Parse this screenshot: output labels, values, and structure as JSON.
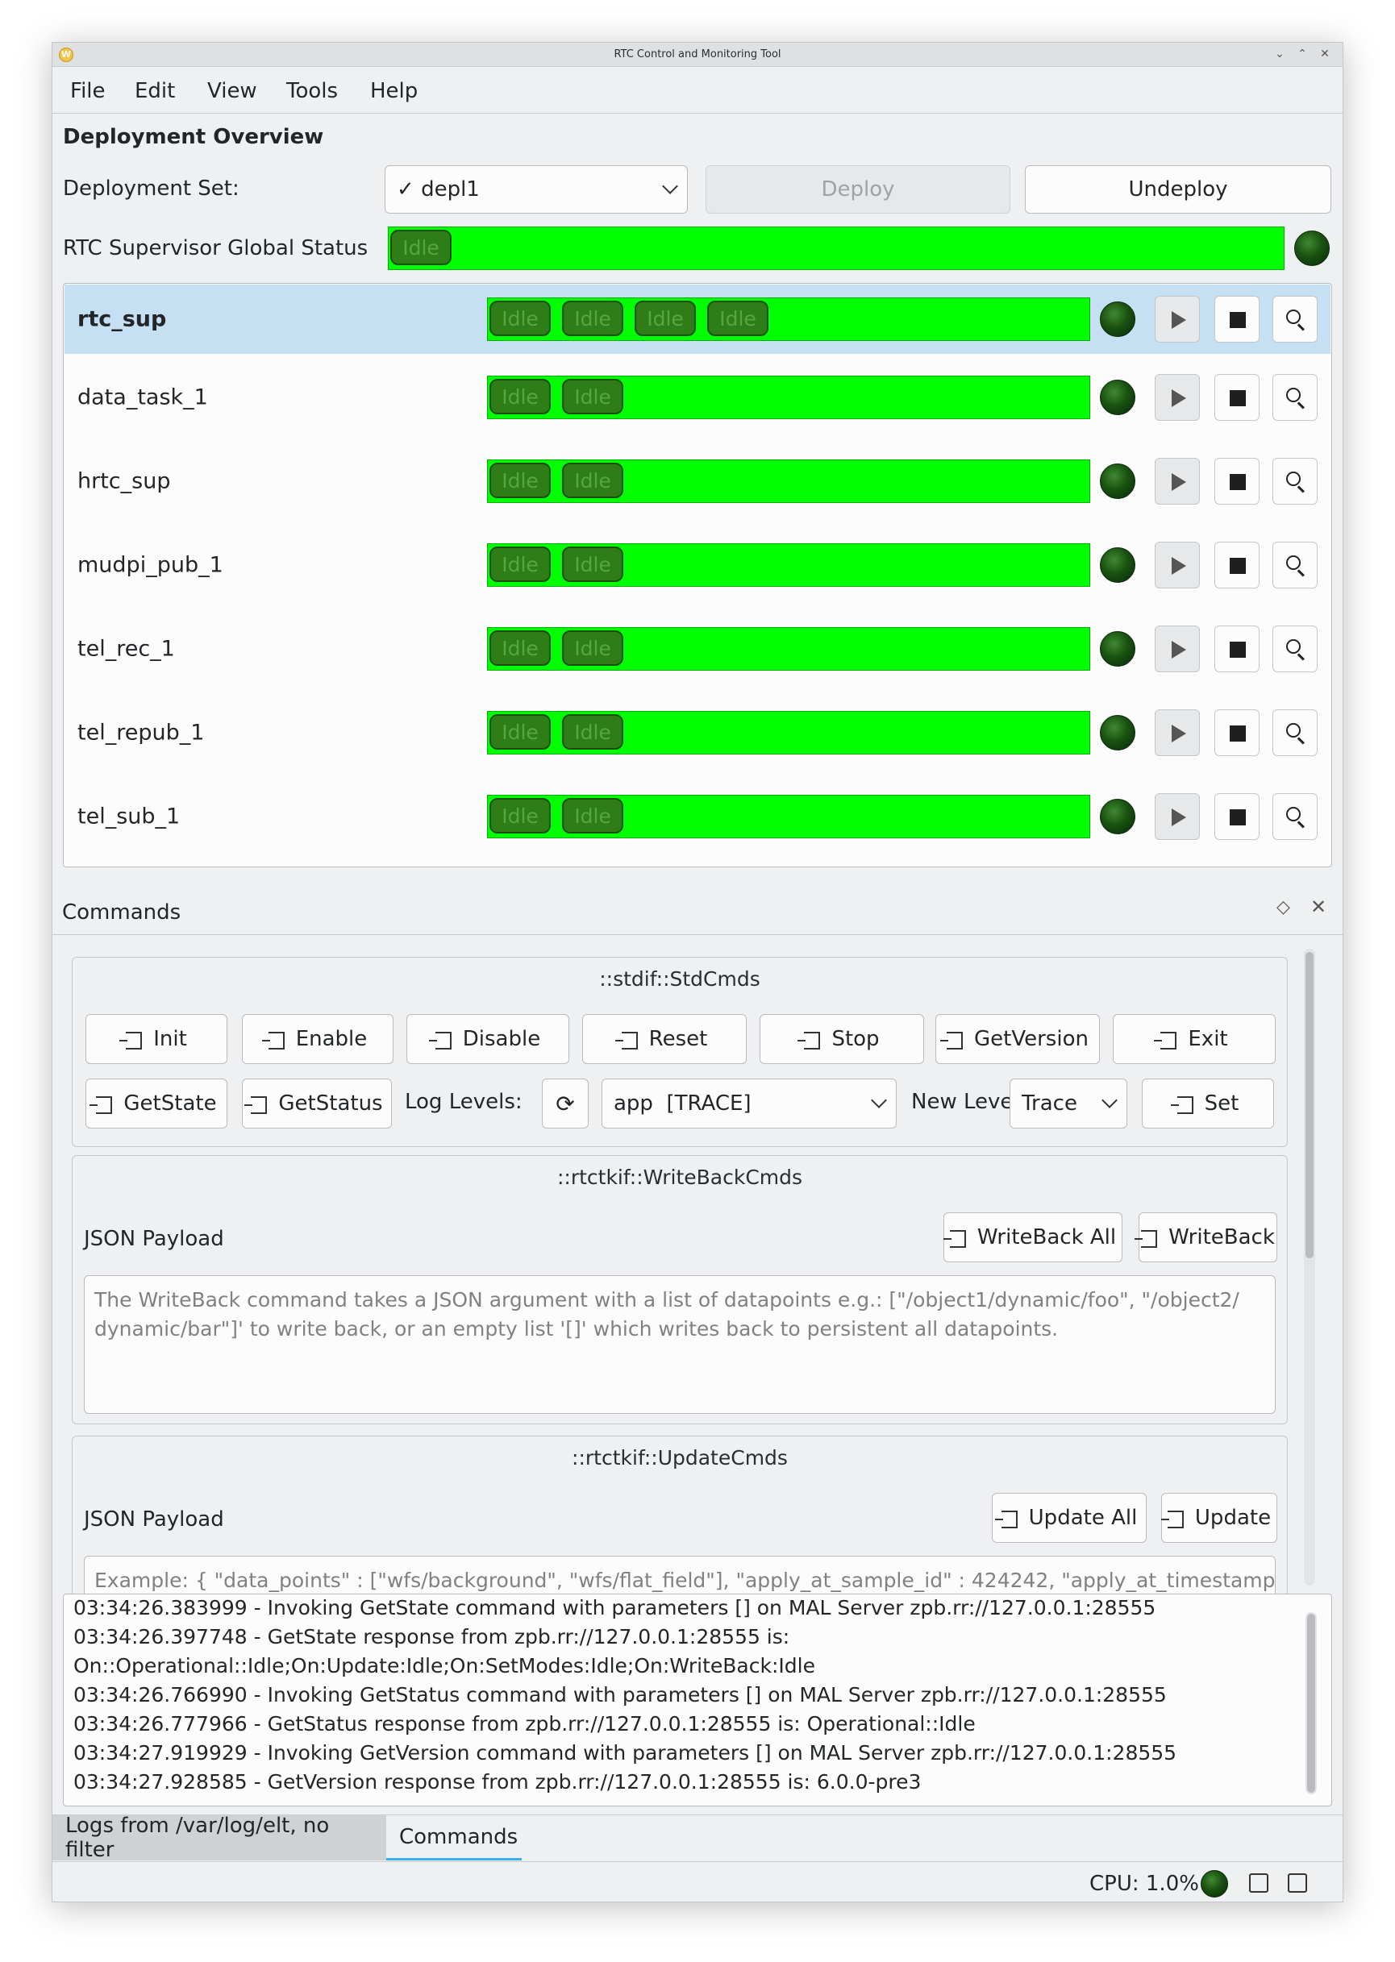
{
  "window": {
    "title": "RTC Control and Monitoring Tool"
  },
  "menu": {
    "items": [
      "File",
      "Edit",
      "View",
      "Tools",
      "Help"
    ]
  },
  "overview": {
    "title": "Deployment Overview",
    "deployment_set_label": "Deployment Set:",
    "deployment_set_value": "depl1",
    "deploy_label": "Deploy",
    "undeploy_label": "Undeploy",
    "global_status_label": "RTC Supervisor Global Status",
    "global_status": "Idle",
    "status_color": "#00ff00"
  },
  "services": [
    {
      "name": "rtc_sup",
      "states": [
        "Idle",
        "Idle",
        "Idle",
        "Idle"
      ],
      "selected": true
    },
    {
      "name": "data_task_1",
      "states": [
        "Idle",
        "Idle"
      ]
    },
    {
      "name": "hrtc_sup",
      "states": [
        "Idle",
        "Idle"
      ]
    },
    {
      "name": "mudpi_pub_1",
      "states": [
        "Idle",
        "Idle"
      ]
    },
    {
      "name": "tel_rec_1",
      "states": [
        "Idle",
        "Idle"
      ]
    },
    {
      "name": "tel_repub_1",
      "states": [
        "Idle",
        "Idle"
      ]
    },
    {
      "name": "tel_sub_1",
      "states": [
        "Idle",
        "Idle"
      ]
    }
  ],
  "commands": {
    "title": "Commands",
    "std": {
      "title": "::stdif::StdCmds",
      "buttons": [
        "Init",
        "Enable",
        "Disable",
        "Reset",
        "Stop",
        "GetVersion",
        "Exit",
        "GetState",
        "GetStatus"
      ],
      "log_levels_label": "Log Levels:",
      "log_level_value": "app  [TRACE]",
      "new_level_label": "New Level:",
      "new_level_value": "Trace",
      "set_label": "Set"
    },
    "writeback": {
      "title": "::rtctkif::WriteBackCmds",
      "payload_label": "JSON Payload",
      "all_label": "WriteBack All",
      "one_label": "WriteBack",
      "placeholder_line1": "The WriteBack command takes a JSON argument with a list of datapoints e.g.: [\"/object1/dynamic/foo\", \"/object2/",
      "placeholder_line2": "dynamic/bar\"]' to write back, or an empty list '[]' which writes back to persistent all datapoints."
    },
    "update": {
      "title": "::rtctkif::UpdateCmds",
      "payload_label": "JSON Payload",
      "all_label": "Update All",
      "one_label": "Update",
      "placeholder": "Example: { \"data_points\" : [\"wfs/background\", \"wfs/flat_field\"], \"apply_at_sample_id\" : 424242, \"apply_at_timestamp\" :"
    }
  },
  "log": {
    "lines": [
      "03:34:26.383999 - Invoking GetState command with parameters [] on MAL Server zpb.rr://127.0.0.1:28555",
      "03:34:26.397748 - GetState response from zpb.rr://127.0.0.1:28555 is:",
      "On::Operational::Idle;On:Update:Idle;On:SetModes:Idle;On:WriteBack:Idle",
      "03:34:26.766990 - Invoking GetStatus command with parameters [] on MAL Server zpb.rr://127.0.0.1:28555",
      "03:34:26.777966 - GetStatus response from zpb.rr://127.0.0.1:28555 is: Operational::Idle",
      "03:34:27.919929 - Invoking GetVersion command with parameters [] on MAL Server zpb.rr://127.0.0.1:28555",
      "03:34:27.928585 - GetVersion response from zpb.rr://127.0.0.1:28555 is: 6.0.0-pre3"
    ]
  },
  "tabs": {
    "logs": "Logs from /var/log/elt, no filter",
    "commands": "Commands"
  },
  "status": {
    "cpu": "CPU: 1.0%"
  }
}
